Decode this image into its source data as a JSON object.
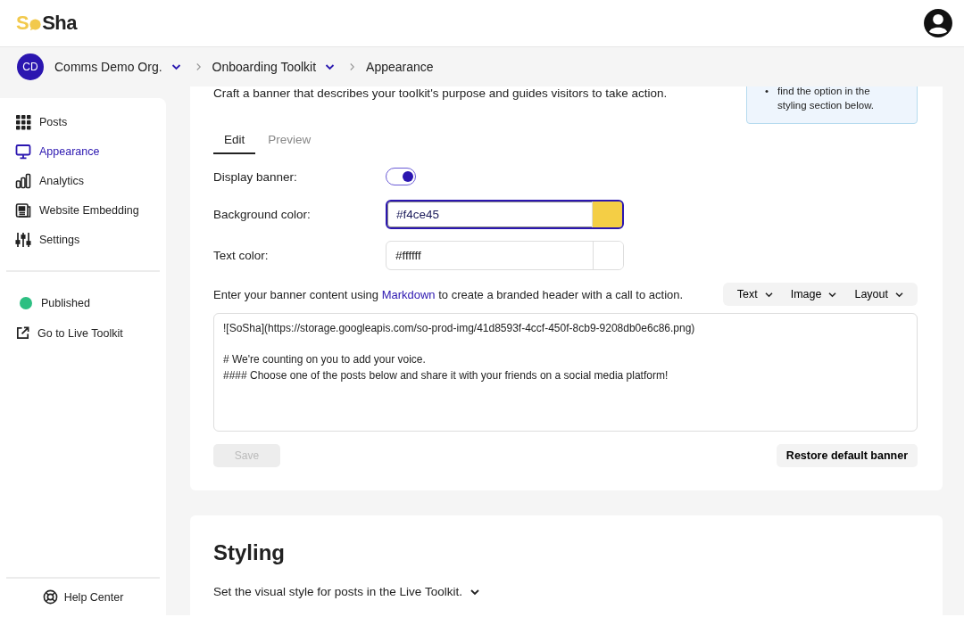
{
  "header": {
    "logo": {
      "lead": "S",
      "tail": "Sha"
    }
  },
  "breadcrumb": {
    "avatar": "CD",
    "items": [
      {
        "label": "Comms Demo Org.",
        "dropdown": true
      },
      {
        "label": "Onboarding Toolkit",
        "dropdown": true
      },
      {
        "label": "Appearance",
        "dropdown": false
      }
    ]
  },
  "sidebar": {
    "items": [
      {
        "label": "Posts",
        "kind": "grid",
        "selected": false
      },
      {
        "label": "Appearance",
        "kind": "monitor",
        "selected": true
      },
      {
        "label": "Analytics",
        "kind": "bars",
        "selected": false
      },
      {
        "label": "Website Embedding",
        "kind": "embed",
        "selected": false
      },
      {
        "label": "Settings",
        "kind": "sliders",
        "selected": false
      }
    ],
    "status": {
      "label": "Published",
      "color": "#2dbf82"
    },
    "live_link": "Go to Live Toolkit",
    "help": "Help Center"
  },
  "banner": {
    "description": "Craft a banner that describes your toolkit's purpose and guides visitors to take action.",
    "info": {
      "bullet": "•",
      "text": "find the option in the styling section below."
    },
    "tabs": [
      {
        "label": "Edit",
        "selected": true
      },
      {
        "label": "Preview",
        "selected": false
      }
    ],
    "fields": [
      {
        "kind": "toggle",
        "label": "Display banner:",
        "on": true
      },
      {
        "kind": "color",
        "label": "Background color:",
        "value": "#f4ce45",
        "focused": true
      },
      {
        "kind": "color",
        "label": "Text color:",
        "value": "#ffffff",
        "focused": false
      }
    ],
    "content_hint": {
      "before": "Enter your banner content using ",
      "link": "Markdown",
      "after": " to create a branded header with a call to action."
    },
    "toolbar": [
      "Text",
      "Image",
      "Layout"
    ],
    "editor_paragraphs": [
      [
        "![SoSha](https://storage.googleapis.com/so-prod-img/41d8593f-4ccf-450f-8cb9-9208db0e6c86.png)"
      ],
      [
        "# We're counting on you to add your voice.",
        "#### Choose one of the posts below and share it with your friends on a social media platform!"
      ]
    ],
    "save": {
      "label": "Save",
      "disabled": true
    },
    "restore": "Restore default banner"
  },
  "styling": {
    "title": "Styling",
    "subtitle": "Set the visual style for posts in the Live Toolkit."
  }
}
